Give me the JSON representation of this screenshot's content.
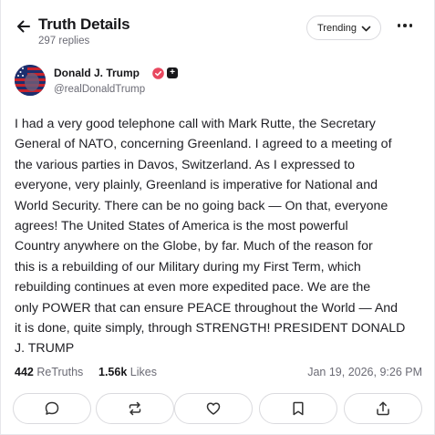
{
  "header": {
    "title": "Truth Details",
    "replies": "297 replies",
    "trending_label": "Trending"
  },
  "author": {
    "name": "Donald J. Trump",
    "handle": "@realDonaldTrump",
    "plus_badge": "+"
  },
  "post": {
    "lines": [
      "I had a very good telephone call with Mark Rutte, the Secretary",
      "General of NATO, concerning Greenland. I agreed to a meeting of",
      "the various parties in Davos, Switzerland. As I expressed to",
      "everyone, very plainly, Greenland is imperative for National and",
      "World Security. There can be no going back — On that, everyone",
      "agrees! The United States of America is the most powerful",
      "Country anywhere on the Globe, by far. Much of the reason for",
      "this is a rebuilding of our Military during my First Term, which",
      "rebuilding continues at even more expedited pace. We are the",
      "only POWER that can ensure PEACE throughout the World — And",
      "it is done, quite simply, through STRENGTH! PRESIDENT DONALD",
      "J. TRUMP"
    ]
  },
  "stats": {
    "retruths_count": "442",
    "retruths_label": "ReTruths",
    "likes_count": "1.56k",
    "likes_label": "Likes",
    "timestamp": "Jan 19, 2026, 9:26 PM"
  },
  "icons": {
    "back": "arrow-left-icon",
    "trending_chevron": "chevron-down-icon",
    "more": "more-horizontal-icon",
    "verified": "verified-badge-icon",
    "reply": "comment-icon",
    "retruth": "repost-icon",
    "like": "heart-icon",
    "bookmark": "bookmark-icon",
    "share": "share-icon"
  },
  "colors": {
    "verified": "#e8485f",
    "text": "#17171a",
    "muted": "#6b6b75",
    "border": "#dadade"
  }
}
